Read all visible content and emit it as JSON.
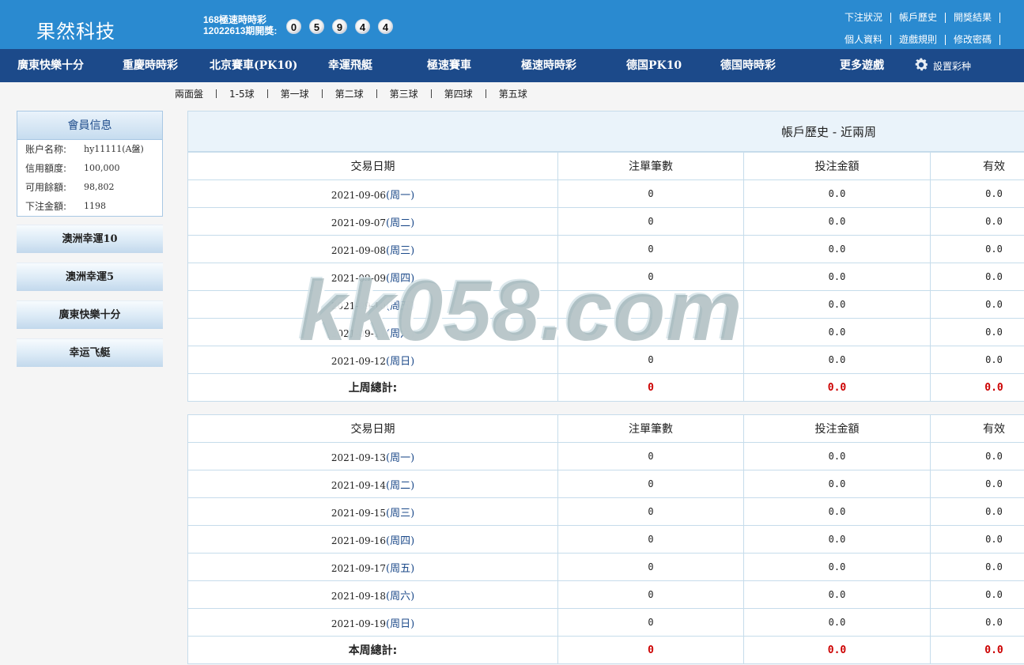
{
  "header": {
    "logo": "果然科技",
    "lottery_name": "168極速時時彩",
    "issue_label": "12022613期開獎:",
    "balls": [
      "0",
      "5",
      "9",
      "4",
      "4"
    ],
    "top_links_row1": [
      "下注狀況",
      "帳戶歷史",
      "開獎結果"
    ],
    "top_links_row2": [
      "個人資料",
      "遊戲規則",
      "修改密碼"
    ]
  },
  "nav": {
    "items": [
      "廣東快樂十分",
      "重慶時時彩",
      "北京賽車(PK10)",
      "幸運飛艇",
      "極速賽車",
      "極速時時彩",
      "德国PK10",
      "德国時時彩",
      "更多遊戲"
    ],
    "settings": "設置彩种"
  },
  "subnav": [
    "兩面盤",
    "1-5球",
    "第一球",
    "第二球",
    "第三球",
    "第四球",
    "第五球"
  ],
  "sidebar": {
    "member_title": "會員信息",
    "member_rows": [
      {
        "label": "账户名称:",
        "value": "hy11111(A盤)"
      },
      {
        "label": "信用額度:",
        "value": "100,000"
      },
      {
        "label": "可用餘額:",
        "value": "98,802"
      },
      {
        "label": "下注金額:",
        "value": "1198"
      }
    ],
    "buttons": [
      "澳洲幸運10",
      "澳洲幸運5",
      "廣東快樂十分",
      "幸运飞艇"
    ]
  },
  "main": {
    "title": "帳戶歷史 - 近兩周",
    "columns": [
      "交易日期",
      "注單筆數",
      "投注金額",
      "有效"
    ],
    "last_week": {
      "rows": [
        {
          "date": "2021-09-06",
          "weekday": "(周一)",
          "count": "0",
          "amount": "0.0",
          "valid": "0.0"
        },
        {
          "date": "2021-09-07",
          "weekday": "(周二)",
          "count": "0",
          "amount": "0.0",
          "valid": "0.0"
        },
        {
          "date": "2021-09-08",
          "weekday": "(周三)",
          "count": "0",
          "amount": "0.0",
          "valid": "0.0"
        },
        {
          "date": "2021-09-09",
          "weekday": "(周四)",
          "count": "0",
          "amount": "0.0",
          "valid": "0.0"
        },
        {
          "date": "2021-09-10",
          "weekday": "(周五)",
          "count": "0",
          "amount": "0.0",
          "valid": "0.0"
        },
        {
          "date": "2021-09-11",
          "weekday": "(周六)",
          "count": "0",
          "amount": "0.0",
          "valid": "0.0"
        },
        {
          "date": "2021-09-12",
          "weekday": "(周日)",
          "count": "0",
          "amount": "0.0",
          "valid": "0.0"
        }
      ],
      "total_label": "上周總計:",
      "total": {
        "count": "0",
        "amount": "0.0",
        "valid": "0.0"
      }
    },
    "this_week": {
      "rows": [
        {
          "date": "2021-09-13",
          "weekday": "(周一)",
          "count": "0",
          "amount": "0.0",
          "valid": "0.0"
        },
        {
          "date": "2021-09-14",
          "weekday": "(周二)",
          "count": "0",
          "amount": "0.0",
          "valid": "0.0"
        },
        {
          "date": "2021-09-15",
          "weekday": "(周三)",
          "count": "0",
          "amount": "0.0",
          "valid": "0.0"
        },
        {
          "date": "2021-09-16",
          "weekday": "(周四)",
          "count": "0",
          "amount": "0.0",
          "valid": "0.0"
        },
        {
          "date": "2021-09-17",
          "weekday": "(周五)",
          "count": "0",
          "amount": "0.0",
          "valid": "0.0"
        },
        {
          "date": "2021-09-18",
          "weekday": "(周六)",
          "count": "0",
          "amount": "0.0",
          "valid": "0.0"
        },
        {
          "date": "2021-09-19",
          "weekday": "(周日)",
          "count": "0",
          "amount": "0.0",
          "valid": "0.0"
        }
      ],
      "total_label": "本周總計:",
      "total": {
        "count": "0",
        "amount": "0.0",
        "valid": "0.0"
      }
    }
  },
  "watermark": "kk058.com",
  "colors": {
    "header_bg": "#2a8ad0",
    "nav_bg": "#1c4a8a",
    "total_red": "#cc0000"
  }
}
